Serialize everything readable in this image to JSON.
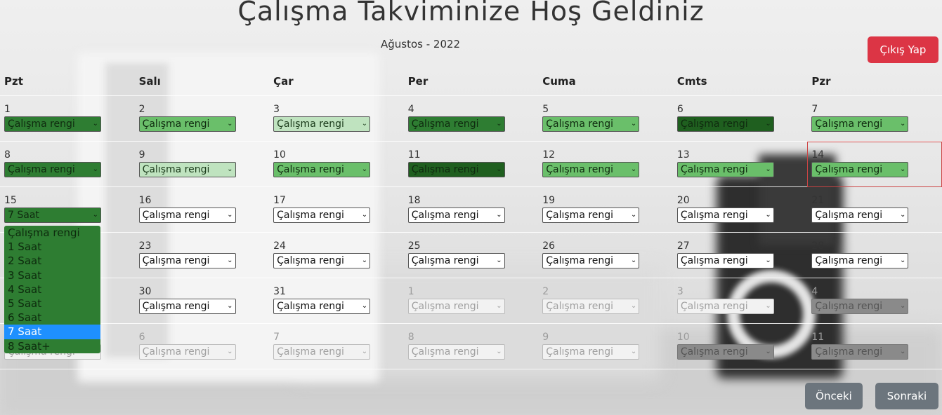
{
  "title": "Çalışma Takviminize Hoş Geldiniz",
  "month": "Ağustos - 2022",
  "logout_label": "Çıkış Yap",
  "prev_label": "Önceki",
  "next_label": "Sonraki",
  "weekdays": [
    "Pzt",
    "Salı",
    "Çar",
    "Per",
    "Cuma",
    "Cmts",
    "Pzr"
  ],
  "select_placeholder": "Çalışma rengi",
  "weeks": [
    [
      {
        "day": "1",
        "value": "Çalışma rengi",
        "shade": "mid"
      },
      {
        "day": "2",
        "value": "Çalışma rengi",
        "shade": "light"
      },
      {
        "day": "3",
        "value": "Çalışma rengi",
        "shade": "pale"
      },
      {
        "day": "4",
        "value": "Çalışma rengi",
        "shade": "mid"
      },
      {
        "day": "5",
        "value": "Çalışma rengi",
        "shade": "light"
      },
      {
        "day": "6",
        "value": "Çalışma rengi",
        "shade": "dark"
      },
      {
        "day": "7",
        "value": "Çalışma rengi",
        "shade": "light"
      }
    ],
    [
      {
        "day": "8",
        "value": "Çalışma rengi",
        "shade": "mid"
      },
      {
        "day": "9",
        "value": "Çalışma rengi",
        "shade": "pale"
      },
      {
        "day": "10",
        "value": "Çalışma rengi",
        "shade": "light"
      },
      {
        "day": "11",
        "value": "Çalışma rengi",
        "shade": "dark"
      },
      {
        "day": "12",
        "value": "Çalışma rengi",
        "shade": "light"
      },
      {
        "day": "13",
        "value": "Çalışma rengi",
        "shade": "light"
      },
      {
        "day": "14",
        "value": "Çalışma rengi",
        "shade": "light",
        "focus": true
      }
    ],
    [
      {
        "day": "15",
        "value": "7 Saat",
        "shade": "mid"
      },
      {
        "day": "16",
        "value": "Çalışma rengi",
        "shade": ""
      },
      {
        "day": "17",
        "value": "Çalışma rengi",
        "shade": ""
      },
      {
        "day": "18",
        "value": "Çalışma rengi",
        "shade": ""
      },
      {
        "day": "19",
        "value": "Çalışma rengi",
        "shade": ""
      },
      {
        "day": "20",
        "value": "Çalışma rengi",
        "shade": ""
      },
      {
        "day": "21",
        "value": "Çalışma rengi",
        "shade": ""
      }
    ],
    [
      {
        "day": "",
        "value": "",
        "shade": "hidden"
      },
      {
        "day": "23",
        "value": "Çalışma rengi",
        "shade": ""
      },
      {
        "day": "24",
        "value": "Çalışma rengi",
        "shade": ""
      },
      {
        "day": "25",
        "value": "Çalışma rengi",
        "shade": ""
      },
      {
        "day": "26",
        "value": "Çalışma rengi",
        "shade": ""
      },
      {
        "day": "27",
        "value": "Çalışma rengi",
        "shade": ""
      },
      {
        "day": "28",
        "value": "Çalışma rengi",
        "shade": ""
      }
    ],
    [
      {
        "day": "",
        "value": "",
        "shade": "hidden"
      },
      {
        "day": "30",
        "value": "Çalışma rengi",
        "shade": ""
      },
      {
        "day": "31",
        "value": "Çalışma rengi",
        "shade": ""
      },
      {
        "day": "1",
        "value": "Çalışma rengi",
        "shade": "other"
      },
      {
        "day": "2",
        "value": "Çalışma rengi",
        "shade": "other"
      },
      {
        "day": "3",
        "value": "Çalışma rengi",
        "shade": "other"
      },
      {
        "day": "4",
        "value": "Çalışma rengi",
        "shade": "otherdim"
      }
    ],
    [
      {
        "day": "",
        "value": "Çalışma rengi",
        "shade": "otherhidden"
      },
      {
        "day": "6",
        "value": "Çalışma rengi",
        "shade": "other"
      },
      {
        "day": "7",
        "value": "Çalışma rengi",
        "shade": "other"
      },
      {
        "day": "8",
        "value": "Çalışma rengi",
        "shade": "other"
      },
      {
        "day": "9",
        "value": "Çalışma rengi",
        "shade": "other"
      },
      {
        "day": "10",
        "value": "Çalışma rengi",
        "shade": "otherdim"
      },
      {
        "day": "11",
        "value": "Çalışma rengi",
        "shade": "otherdim"
      }
    ]
  ],
  "dropdown_options": [
    "Çalışma rengi",
    "1 Saat",
    "2 Saat",
    "3 Saat",
    "4 Saat",
    "5 Saat",
    "6 Saat",
    "7 Saat",
    "8 Saat+"
  ],
  "dropdown_selected_index": 7,
  "colors": {
    "danger": "#dc3545",
    "secondary": "#6c757d",
    "highlight": "#1e90ff",
    "green_dark": "#1f5f1f",
    "green_mid": "#2e7d32",
    "green_light": "#6abf6a",
    "green_pale": "#bfe3bf"
  }
}
